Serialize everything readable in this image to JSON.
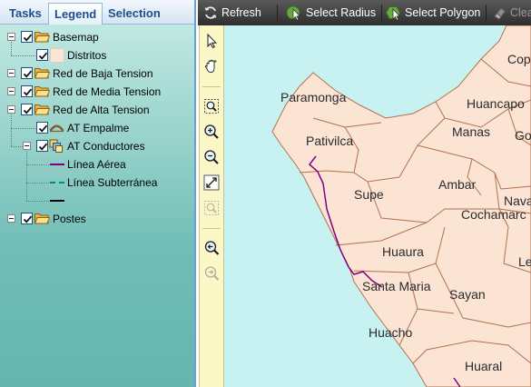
{
  "tabs": [
    {
      "label": "Tasks",
      "active": false
    },
    {
      "label": "Legend",
      "active": true
    },
    {
      "label": "Selection",
      "active": false
    }
  ],
  "legend": {
    "basemap": {
      "label": "Basemap",
      "checked": true,
      "icon": "folder-icon",
      "children": [
        {
          "label": "Distritos",
          "checked": true,
          "swatch": "polygon-swatch"
        }
      ]
    },
    "red_baja_tension": {
      "label": "Red de Baja Tension",
      "checked": true,
      "icon": "folder-icon"
    },
    "red_media_tension": {
      "label": "Red de Media Tension",
      "checked": true,
      "icon": "folder-icon"
    },
    "red_alta_tension": {
      "label": "Red de Alta Tension",
      "checked": true,
      "icon": "folder-icon",
      "children": [
        {
          "label": "AT Empalme",
          "checked": true,
          "icon": "empalme-icon"
        },
        {
          "label": "AT Conductores",
          "checked": true,
          "icon": "layer-group-icon",
          "children": [
            {
              "label": "Línea Aérea",
              "swatch": "solid-line",
              "color": "#800080"
            },
            {
              "label": "Línea Subterránea",
              "swatch": "dashed-line",
              "color": "#008b8b"
            },
            {
              "label": "",
              "swatch": "solid-line",
              "color": "#000000"
            }
          ]
        }
      ]
    },
    "postes": {
      "label": "Postes",
      "checked": true,
      "icon": "folder-icon"
    }
  },
  "toolbar": {
    "refresh": {
      "label": "Refresh",
      "icon": "refresh-icon"
    },
    "select_radius": {
      "label": "Select Radius",
      "icon": "select-radius-icon"
    },
    "select_polygon": {
      "label": "Select Polygon",
      "icon": "select-polygon-icon"
    },
    "clear": {
      "label": "Clear",
      "icon": "eraser-icon",
      "enabled": false
    }
  },
  "tools": {
    "items": [
      "pointer-icon",
      "pan-icon",
      "zoom-box-icon",
      "zoom-in-icon",
      "zoom-out-icon",
      "full-extent-icon",
      "zoom-box-disabled-icon",
      "zoom-previous-icon",
      "zoom-next-icon"
    ]
  },
  "map": {
    "labels": [
      "Copo",
      "Huancapo",
      "Manas",
      "Go",
      "Ambar",
      "Nava",
      "Cochamarc",
      "Le",
      "Supe",
      "Huaura",
      "Santa Maria",
      "Sayan",
      "Huacho",
      "Huaral",
      "Paramonga",
      "Pativilca"
    ]
  },
  "colors": {
    "sea": "#c8f2f2",
    "land": "#fce4d4",
    "district_border": "#b0714e",
    "aerial_line": "#800080",
    "underground_line": "#008b8b",
    "panel_top": "#c9ede7",
    "panel_bottom": "#6fbdb5",
    "toolbar_top": "#5a5a5a",
    "toolbar_bottom": "#2e2e2e",
    "tool_column": "#fbf7c6",
    "tab_text": "#1f4e8a"
  }
}
